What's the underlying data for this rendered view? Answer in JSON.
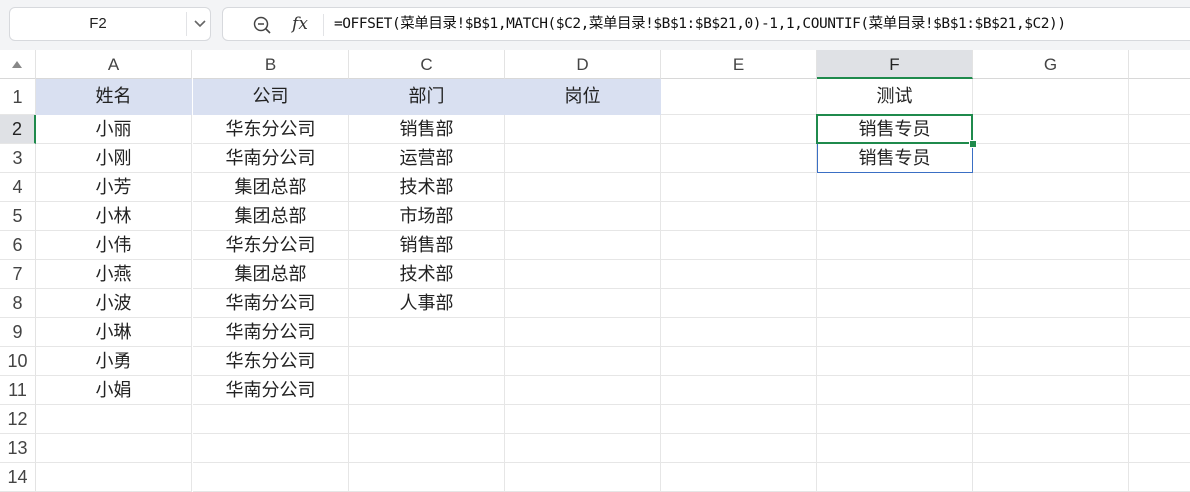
{
  "name_box": {
    "value": "F2"
  },
  "formula_bar": {
    "zoom_icon": "zoom-icon",
    "fx_label": "fx",
    "formula": "=OFFSET(菜单目录!$B$1,MATCH($C2,菜单目录!$B$1:$B$21,0)-1,1,COUNTIF(菜单目录!$B$1:$B$21,$C2))"
  },
  "columns": [
    "A",
    "B",
    "C",
    "D",
    "E",
    "F",
    "G"
  ],
  "selected_column": "F",
  "rows": [
    "1",
    "2",
    "3",
    "4",
    "5",
    "6",
    "7",
    "8",
    "9",
    "10",
    "11",
    "12",
    "13",
    "14"
  ],
  "selected_row": "2",
  "header_row": {
    "A": "姓名",
    "B": "公司",
    "C": "部门",
    "D": "岗位",
    "F": "测试"
  },
  "data_rows": [
    {
      "A": "小丽",
      "B": "华东分公司",
      "C": "销售部",
      "F": "销售专员"
    },
    {
      "A": "小刚",
      "B": "华南分公司",
      "C": "运营部",
      "F": "销售专员"
    },
    {
      "A": "小芳",
      "B": "集团总部",
      "C": "技术部"
    },
    {
      "A": "小林",
      "B": "集团总部",
      "C": "市场部"
    },
    {
      "A": "小伟",
      "B": "华东分公司",
      "C": "销售部"
    },
    {
      "A": "小燕",
      "B": "集团总部",
      "C": "技术部"
    },
    {
      "A": "小波",
      "B": "华南分公司",
      "C": "人事部"
    },
    {
      "A": "小琳",
      "B": "华南分公司"
    },
    {
      "A": "小勇",
      "B": "华东分公司"
    },
    {
      "A": "小娟",
      "B": "华南分公司"
    }
  ],
  "colors": {
    "accent": "#1f8a4c",
    "header_fill": "#d9e0f1",
    "spill_border": "#3a6fc4"
  }
}
